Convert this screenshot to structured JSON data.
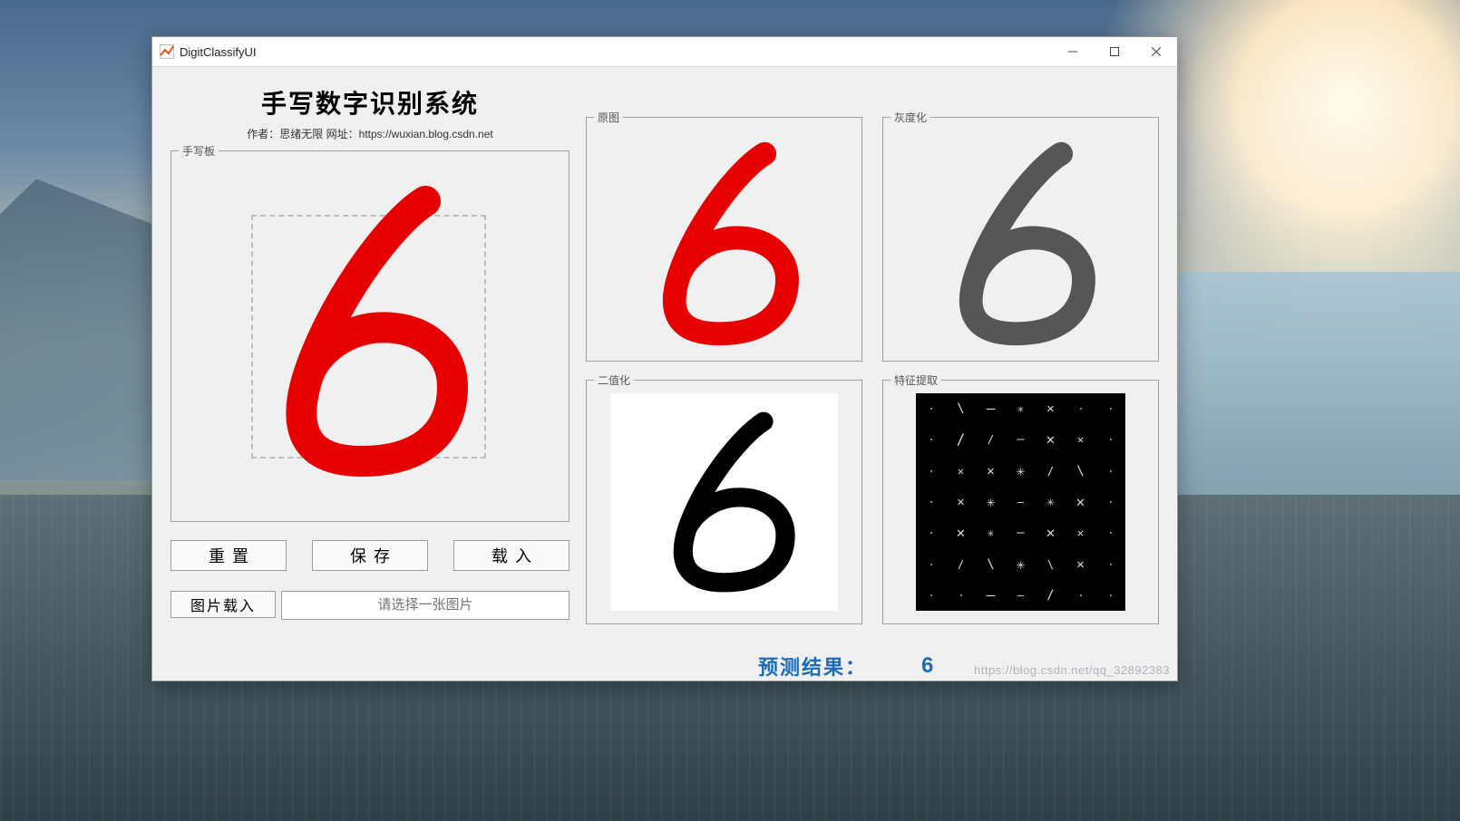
{
  "window": {
    "title": "DigitClassifyUI",
    "controls": {
      "minimize_tooltip": "Minimize",
      "maximize_tooltip": "Maximize",
      "close_tooltip": "Close"
    }
  },
  "header": {
    "title": "手写数字识别系统",
    "author_prefix": "作者：",
    "author_name": "思绪无限",
    "url_prefix": " 网址：",
    "url": "https://wuxian.blog.csdn.net"
  },
  "groups": {
    "draw": "手写板",
    "original": "原图",
    "gray": "灰度化",
    "binary": "二值化",
    "feature": "特征提取"
  },
  "buttons": {
    "reset": "重置",
    "save": "保存",
    "load": "载入",
    "image_load": "图片载入"
  },
  "file_field": {
    "placeholder": "请选择一张图片",
    "value": ""
  },
  "result": {
    "label": "预测结果：",
    "value": "6"
  },
  "digit": {
    "drawn_value": "6",
    "stroke_color": "#e60000",
    "gray_color": "#565656",
    "binary_color": "#000000"
  },
  "watermark": "https://blog.csdn.net/qq_32892383"
}
